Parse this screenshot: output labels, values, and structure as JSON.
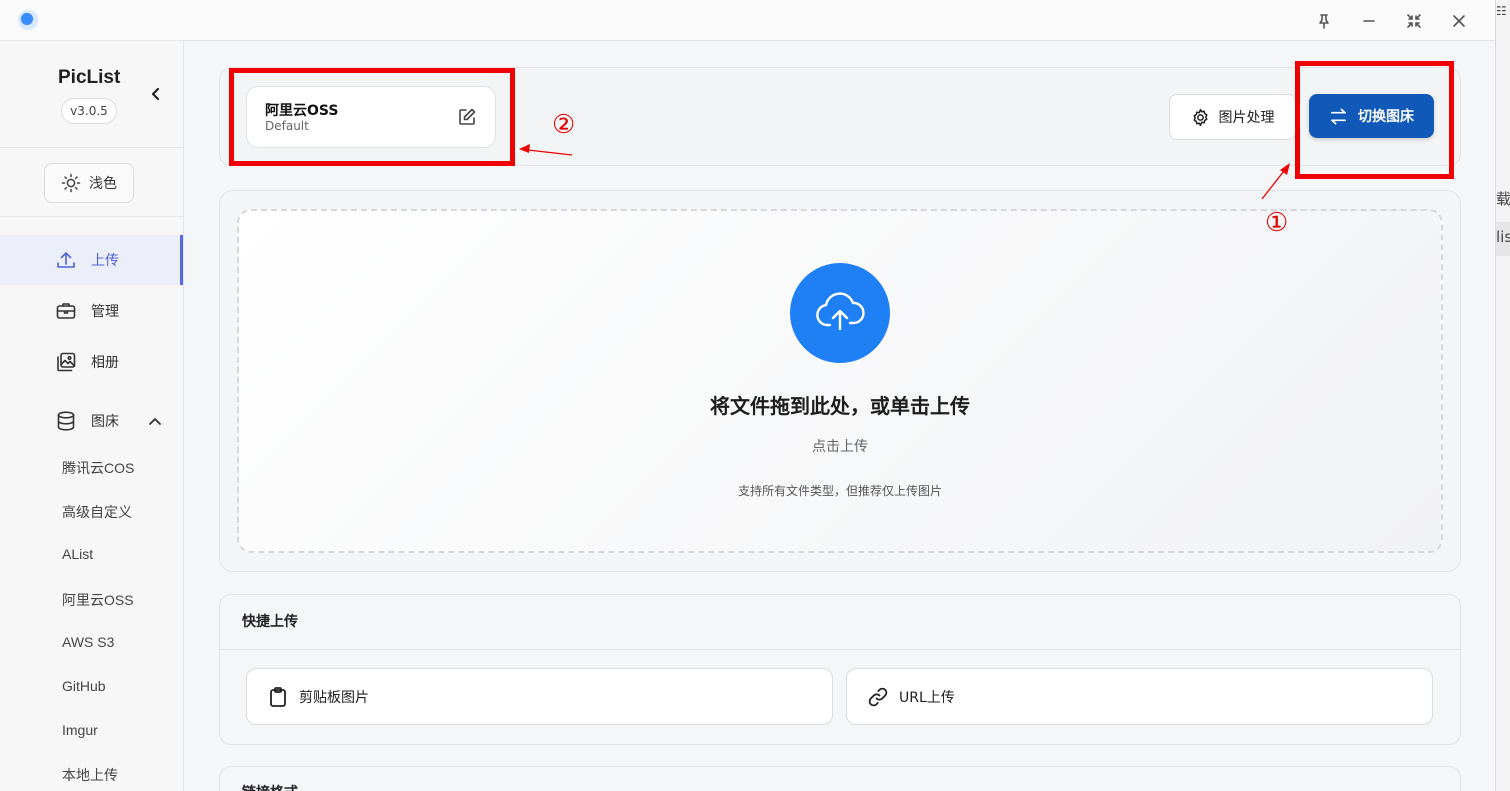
{
  "sidebar": {
    "brand": "PicList",
    "version": "v3.0.5",
    "theme_label": "浅色",
    "nav": [
      {
        "label": "上传",
        "icon": "upload-icon",
        "active": true
      },
      {
        "label": "管理",
        "icon": "briefcase-icon"
      },
      {
        "label": "相册",
        "icon": "gallery-icon"
      },
      {
        "label": "图床",
        "icon": "database-icon",
        "expanded": true
      }
    ],
    "uploaders": [
      "腾讯云COS",
      "高级自定义",
      "AList",
      "阿里云OSS",
      "AWS S3",
      "GitHub",
      "Imgur",
      "本地上传"
    ]
  },
  "current_config": {
    "name": "阿里云OSS",
    "profile": "Default"
  },
  "toolbar": {
    "process_label": "图片处理",
    "switch_label": "切换图床"
  },
  "dropzone": {
    "title": "将文件拖到此处，或单击上传",
    "subtitle": "点击上传",
    "hint": "支持所有文件类型，但推荐仅上传图片"
  },
  "quick_upload": {
    "title": "快捷上传",
    "clipboard_label": "剪贴板图片",
    "url_label": "URL上传"
  },
  "link_format": {
    "title": "链接格式"
  },
  "annotations": {
    "marker_1": "①",
    "marker_2": "②",
    "color": "#f00000"
  },
  "background_window": {
    "fragments": [
      "☷",
      "载信",
      "lis"
    ]
  },
  "colors": {
    "accent": "#1159b8",
    "upload_circle": "#1f80f5",
    "active_nav": "#4e61d6"
  }
}
